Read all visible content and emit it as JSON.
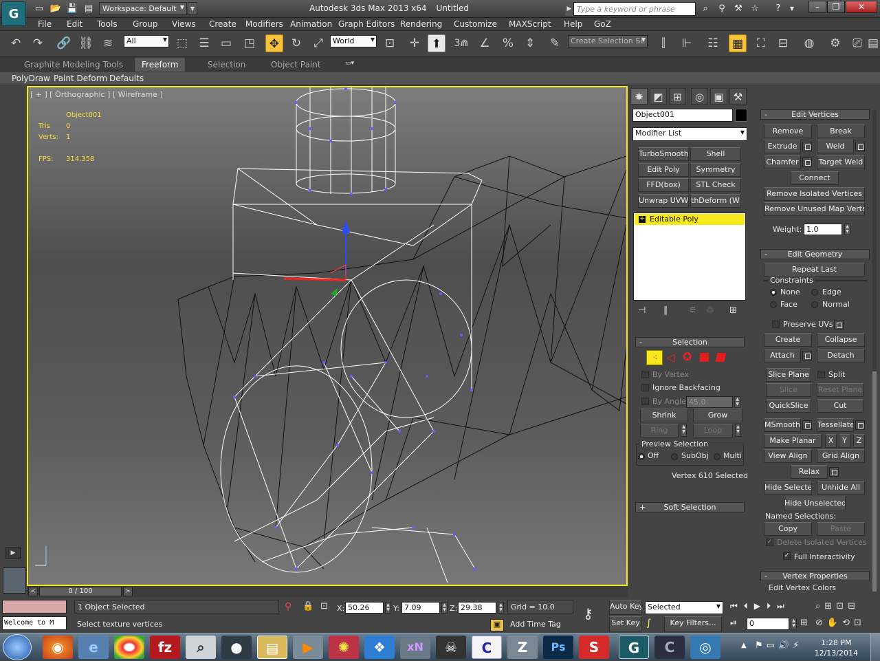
{
  "titlebar": {
    "workspace": "Workspace: Default",
    "app_name": "Autodesk 3ds Max  2013 x64",
    "document": "Untitled",
    "search_placeholder": "Type a keyword or phrase"
  },
  "menu": [
    "File",
    "Edit",
    "Tools",
    "Group",
    "Views",
    "Create",
    "Modifiers",
    "Animation",
    "Graph Editors",
    "Rendering",
    "Customize",
    "MAXScript",
    "Help",
    "GoZ"
  ],
  "toolbar": {
    "filter": "All",
    "coord_system": "World",
    "snap_value": "3",
    "selection_set_placeholder": "Create Selection Se"
  },
  "ribbon": {
    "tabs": [
      "Graphite Modeling Tools",
      "Freeform",
      "Selection",
      "Object Paint"
    ],
    "active_tab": "Freeform",
    "subtabs": [
      "PolyDraw",
      "Paint Deform",
      "Defaults"
    ]
  },
  "viewport": {
    "label": "[ + ] [ Orthographic ] [ Wireframe ]",
    "object": "Object001",
    "tris_label": "Tris",
    "tris": "0",
    "verts_label": "Verts:",
    "verts": "1",
    "fps_label": "FPS:",
    "fps": "314.358"
  },
  "command_panel": {
    "object_name": "Object001",
    "modifier_list": "Modifier List",
    "modifier_buttons": [
      "TurboSmooth",
      "Shell",
      "Edit Poly",
      "Symmetry",
      "FFD(box)",
      "STL Check",
      "Unwrap UVW",
      "thDeform (WSI"
    ],
    "stack_item": "Editable Poly",
    "selection": {
      "title": "Selection",
      "by_vertex": "By Vertex",
      "ignore_backfacing": "Ignore Backfacing",
      "by_angle": "By Angle:",
      "angle": "45.0",
      "shrink": "Shrink",
      "grow": "Grow",
      "ring": "Ring",
      "loop": "Loop",
      "preview_title": "Preview Selection",
      "preview_options": [
        "Off",
        "SubObj",
        "Multi"
      ],
      "status": "Vertex 610 Selected"
    },
    "soft_selection": "Soft Selection",
    "edit_vertices": {
      "title": "Edit Vertices",
      "remove": "Remove",
      "break": "Break",
      "extrude": "Extrude",
      "weld": "Weld",
      "chamfer": "Chamfer",
      "target_weld": "Target Weld",
      "connect": "Connect",
      "remove_isolated": "Remove Isolated Vertices",
      "remove_unused": "Remove Unused Map Verts",
      "weight_label": "Weight:",
      "weight": "1.0"
    },
    "edit_geometry": {
      "title": "Edit Geometry",
      "repeat_last": "Repeat Last",
      "constraints": "Constraints",
      "none": "None",
      "edge": "Edge",
      "face": "Face",
      "normal": "Normal",
      "preserve_uvs": "Preserve UVs",
      "create": "Create",
      "collapse": "Collapse",
      "attach": "Attach",
      "detach": "Detach",
      "slice_plane": "Slice Plane",
      "split": "Split",
      "slice": "Slice",
      "reset_plane": "Reset Plane",
      "quickslice": "QuickSlice",
      "cut": "Cut",
      "msmooth": "MSmooth",
      "tessellate": "Tessellate",
      "make_planar": "Make Planar",
      "x": "X",
      "y": "Y",
      "z": "Z",
      "view_align": "View Align",
      "grid_align": "Grid Align",
      "relax": "Relax",
      "hide_selected": "Hide Selected",
      "unhide_all": "Unhide All",
      "hide_unselected": "Hide Unselected",
      "named_selections": "Named Selections:",
      "copy": "Copy",
      "paste": "Paste",
      "delete_isolated": "Delete Isolated Vertices",
      "full_interactivity": "Full Interactivity"
    },
    "vertex_properties": "Vertex Properties",
    "edit_vertex_colors": "Edit Vertex Colors"
  },
  "timeline": {
    "frame": "0 / 100"
  },
  "status": {
    "selected": "1 Object Selected",
    "prompt": "Select texture vertices",
    "maxscript": "Welcome to M",
    "x_label": "X:",
    "x": "50.26",
    "y_label": "Y:",
    "y": "7.09",
    "z_label": "Z:",
    "z": "29.38",
    "grid": "Grid = 10.0",
    "add_time_tag": "Add Time Tag",
    "auto_key": "Auto Key",
    "set_key": "Set Key",
    "key_mode": "Selected",
    "key_filters": "Key Filters...",
    "frame_field": "0"
  },
  "taskbar": {
    "apps": [
      "internet-explorer",
      "firefox",
      "internet-explorer-2",
      "chrome",
      "filezilla",
      "search-tool",
      "app-dark",
      "folder",
      "media-player",
      "pinwheel",
      "dropbox",
      "xnview",
      "skull-app",
      "cinema-app",
      "zbrush",
      "photoshop",
      "substance",
      "3dsmax",
      "cinema4d",
      "blender-camera"
    ],
    "time": "1:28 PM",
    "date": "12/13/2014"
  },
  "colors": {
    "viewport_border": "#f6e51e",
    "stat_text": "#f6de3b",
    "stack_highlight": "#f7e81b",
    "active_button": "#f7c23b"
  }
}
